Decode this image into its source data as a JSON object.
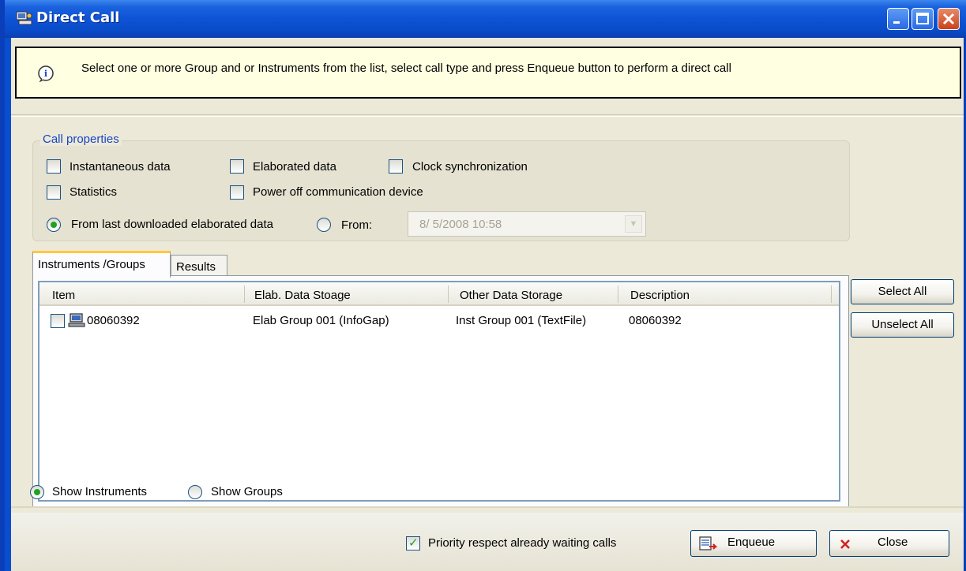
{
  "window": {
    "title": "Direct Call"
  },
  "info": {
    "text": "Select one or more Group and or Instruments from the list, select call type and press Enqueue button to perform a direct call"
  },
  "call_properties": {
    "legend": "Call properties",
    "instantaneous": {
      "label": "Instantaneous data",
      "checked": false
    },
    "elaborated": {
      "label": "Elaborated data",
      "checked": false
    },
    "clock_sync": {
      "label": "Clock synchronization",
      "checked": false
    },
    "statistics": {
      "label": "Statistics",
      "checked": false
    },
    "power_off": {
      "label": "Power off communication device",
      "checked": false
    },
    "from_last": {
      "label": "From last downloaded elaborated data",
      "selected": true
    },
    "from": {
      "label": "From:",
      "selected": false
    },
    "from_date": "8/ 5/2008 10:58"
  },
  "tabs": [
    {
      "label": "Instruments /Groups",
      "active": true
    },
    {
      "label": "Results",
      "active": false
    }
  ],
  "list": {
    "columns": [
      "Item",
      "Elab. Data  Stoage",
      "Other Data Storage",
      "Description"
    ],
    "rows": [
      {
        "item": "08060392",
        "elab": "Elab Group 001 (InfoGap)",
        "other": "Inst Group 001 (TextFile)",
        "description": "08060392",
        "checked": false
      }
    ]
  },
  "side_buttons": {
    "select_all": "Select All",
    "unselect_all": "Unselect All"
  },
  "view_options": {
    "show_instruments": {
      "label": "Show Instruments",
      "selected": true
    },
    "show_groups": {
      "label": "Show Groups",
      "selected": false
    }
  },
  "footer": {
    "priority": {
      "label": "Priority respect already waiting calls",
      "checked": true
    },
    "enqueue_label": "Enqueue",
    "close_label": "Close"
  },
  "colors": {
    "titlebar": "#0a4ed0",
    "info_bg": "#ffffe1",
    "dialog_bg": "#ece9d8",
    "legend": "#1545c8",
    "check": "#21a121"
  }
}
